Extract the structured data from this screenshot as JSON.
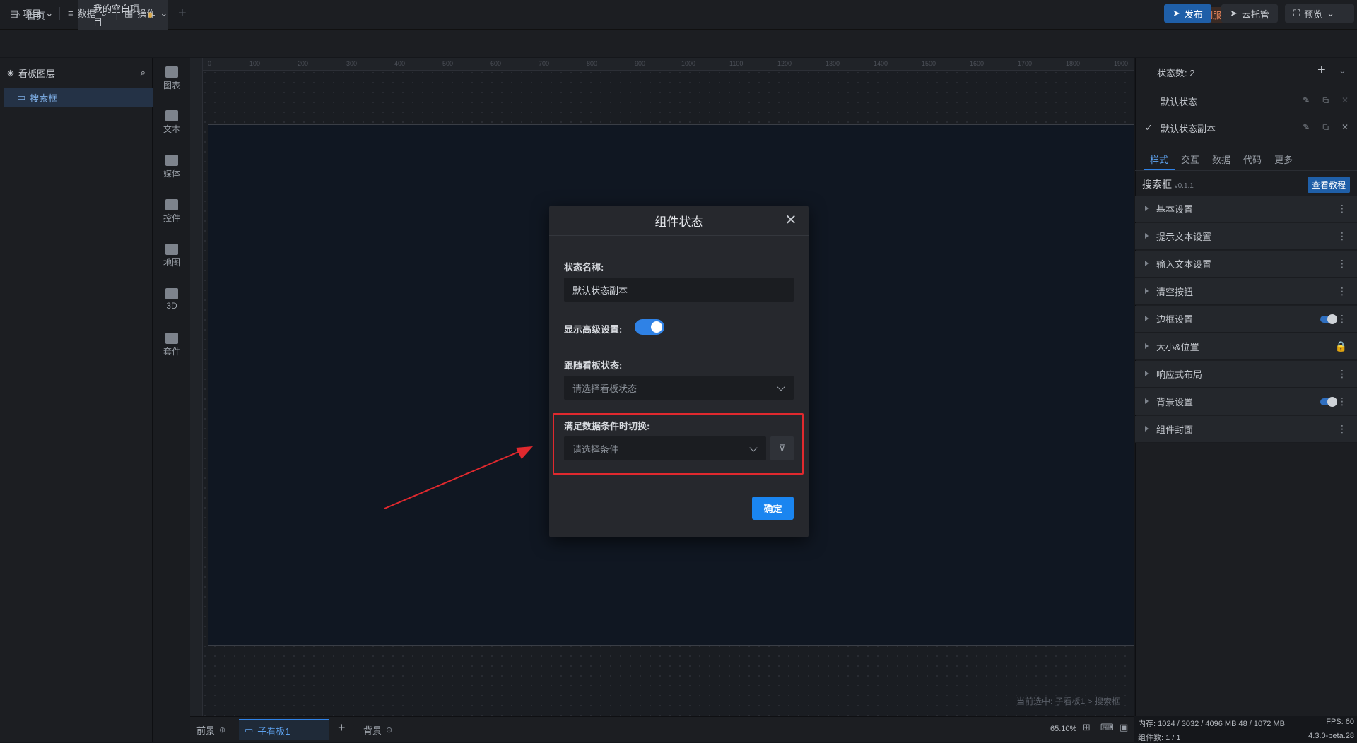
{
  "titlebar": {
    "home_tab": "首页",
    "project_tab": "我的空白项目",
    "custom_service": "定制服务"
  },
  "menubar": {
    "project": "项目",
    "data": "数据",
    "operation": "操作",
    "publish": "发布",
    "cloud_host": "云托管",
    "preview": "预览"
  },
  "layers": {
    "title": "看板图层",
    "items": [
      "搜索框"
    ]
  },
  "component_tools": [
    "图表",
    "文本",
    "媒体",
    "控件",
    "地图",
    "3D",
    "套件"
  ],
  "ruler_ticks": [
    "0",
    "100",
    "200",
    "300",
    "400",
    "500",
    "600",
    "700",
    "800",
    "900",
    "1000",
    "1100",
    "1200",
    "1300",
    "1400",
    "1500",
    "1600",
    "1700",
    "1800",
    "1900"
  ],
  "canvas": {
    "breadcrumb": "当前选中: 子看板1 > 搜索框"
  },
  "bottombar": {
    "foreground": "前景",
    "sub_board": "子看板1",
    "background": "背景",
    "zoom": "65.10%"
  },
  "right_panel": {
    "state_count": "状态数: 2",
    "states": [
      "默认状态",
      "默认状态副本"
    ],
    "tabs": [
      "样式",
      "交互",
      "数据",
      "代码",
      "更多"
    ],
    "component_name": "搜索框",
    "component_version": "v0.1.1",
    "tutorial": "查看教程",
    "sections": [
      "基本设置",
      "提示文本设置",
      "输入文本设置",
      "清空按钮",
      "边框设置",
      "大小&位置",
      "响应式布局",
      "背景设置",
      "组件封面"
    ]
  },
  "statusbar": {
    "memory": "内存: 1024 / 3032 / 4096 MB  48 / 1072 MB",
    "fps": "FPS: 60",
    "components": "组件数: 1 / 1",
    "version": "4.3.0-beta.28"
  },
  "dialog": {
    "title": "组件状态",
    "state_name_label": "状态名称:",
    "state_name_value": "默认状态副本",
    "show_advanced_label": "显示高级设置:",
    "show_advanced_on": true,
    "follow_board_label": "跟随看板状态:",
    "follow_board_placeholder": "请选择看板状态",
    "switch_condition_label": "满足数据条件时切换:",
    "switch_condition_placeholder": "请选择条件",
    "confirm": "确定"
  },
  "colors": {
    "accent": "#2f82e6",
    "highlight": "#e0292e",
    "custom_service": "#e8865f"
  }
}
